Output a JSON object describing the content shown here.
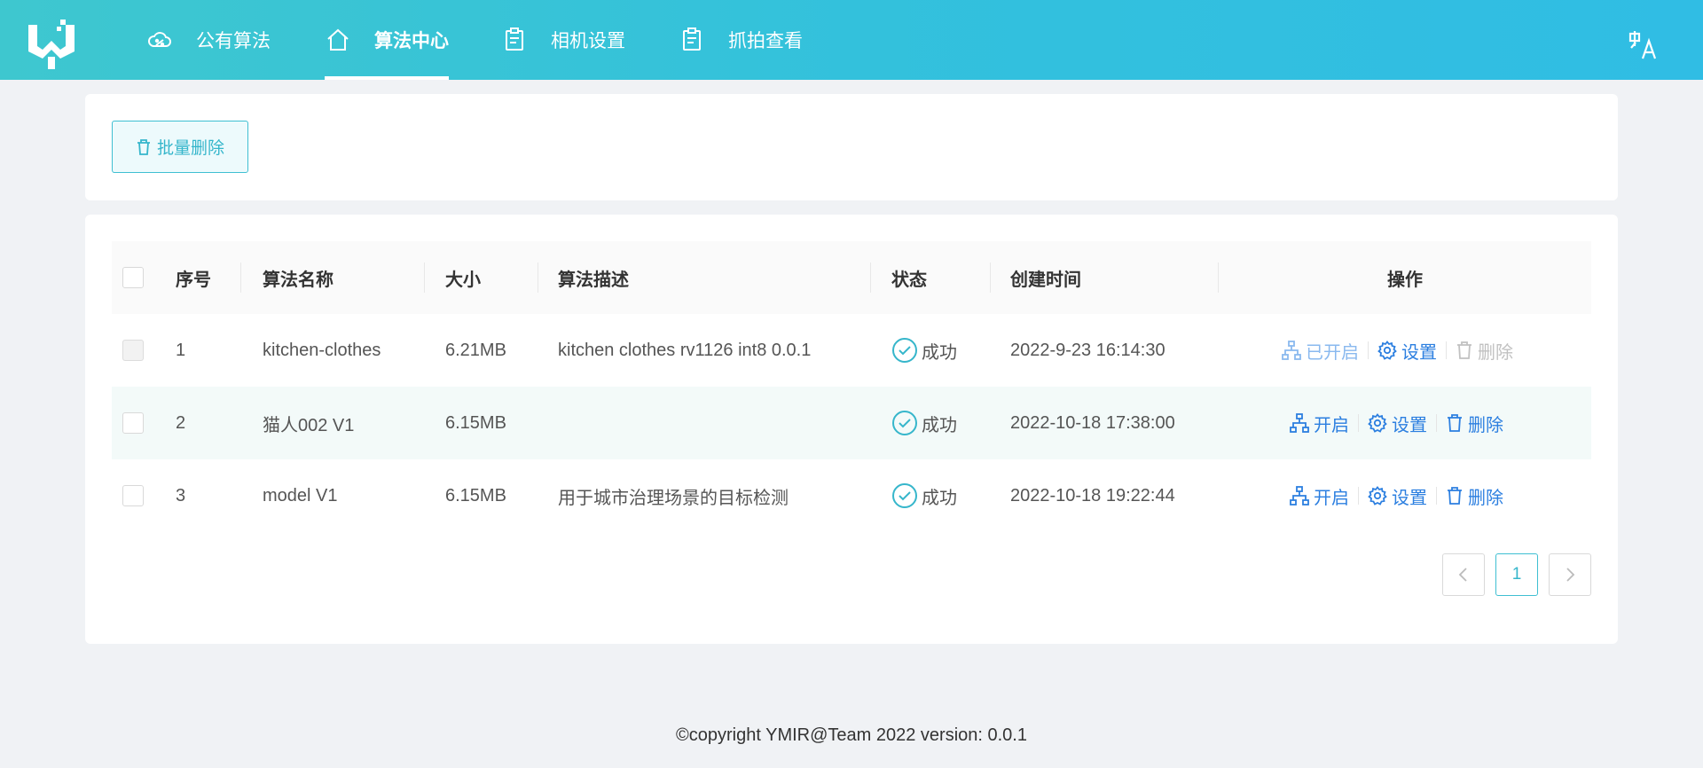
{
  "nav": {
    "items": [
      {
        "label": "公有算法",
        "icon": "cloud-percent-icon"
      },
      {
        "label": "算法中心",
        "icon": "home-icon",
        "active": true
      },
      {
        "label": "相机设置",
        "icon": "clipboard-icon"
      },
      {
        "label": "抓拍查看",
        "icon": "clipboard-icon"
      }
    ],
    "lang_icon": "language-switch-icon"
  },
  "toolbar": {
    "batch_delete_label": "批量删除"
  },
  "table": {
    "columns": [
      "序号",
      "算法名称",
      "大小",
      "算法描述",
      "状态",
      "创建时间",
      "操作"
    ],
    "rows": [
      {
        "index": "1",
        "name": "kitchen-clothes",
        "size": "6.21MB",
        "description": "kitchen clothes rv1126 int8 0.0.1",
        "status": "成功",
        "created": "2022-9-23 16:14:30",
        "toggle_label": "已开启",
        "settings_label": "设置",
        "delete_label": "删除"
      },
      {
        "index": "2",
        "name": "猫人002 V1",
        "size": "6.15MB",
        "description": "",
        "status": "成功",
        "created": "2022-10-18 17:38:00",
        "toggle_label": "开启",
        "settings_label": "设置",
        "delete_label": "删除"
      },
      {
        "index": "3",
        "name": "model V1",
        "size": "6.15MB",
        "description": "用于城市治理场景的目标检测",
        "status": "成功",
        "created": "2022-10-18 19:22:44",
        "toggle_label": "开启",
        "settings_label": "设置",
        "delete_label": "删除"
      }
    ]
  },
  "pagination": {
    "current_page": "1"
  },
  "footer": {
    "text": "©copyright YMIR@Team 2022 version: 0.0.1"
  },
  "colors": {
    "accent": "#36b6cb",
    "link": "#2c7fe0",
    "success": "#36b6cb"
  }
}
